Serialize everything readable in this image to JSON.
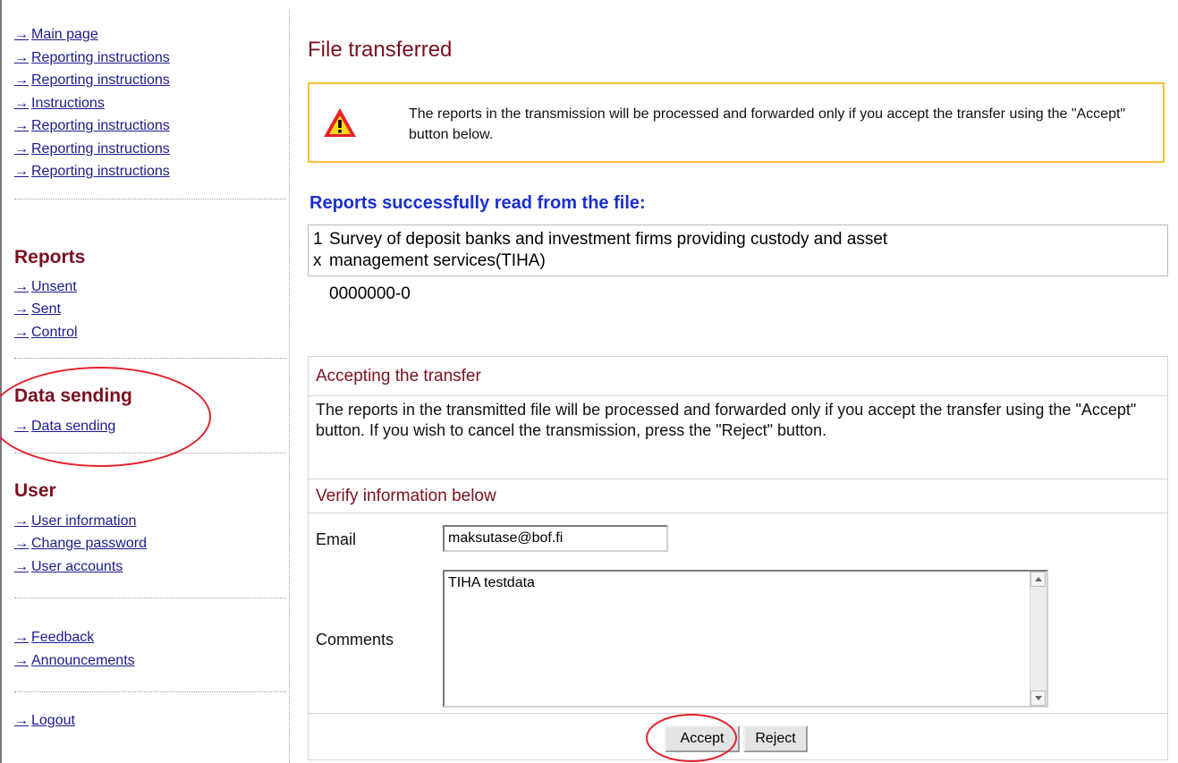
{
  "sidebar": {
    "top_links": [
      {
        "label": "Main page"
      },
      {
        "label": "Reporting instructions"
      },
      {
        "label": "Reporting instructions"
      },
      {
        "label": "Instructions"
      },
      {
        "label": "Reporting instructions"
      },
      {
        "label": "Reporting instructions"
      },
      {
        "label": "Reporting instructions"
      }
    ],
    "reports": {
      "heading": "Reports",
      "links": [
        {
          "label": "Unsent"
        },
        {
          "label": "Sent"
        },
        {
          "label": "Control"
        }
      ]
    },
    "data_sending": {
      "heading": "Data sending",
      "links": [
        {
          "label": "Data sending"
        }
      ]
    },
    "user": {
      "heading": "User",
      "links": [
        {
          "label": "User information"
        },
        {
          "label": "Change password"
        },
        {
          "label": "User accounts"
        }
      ]
    },
    "misc_links": [
      {
        "label": "Feedback"
      },
      {
        "label": "Announcements"
      }
    ],
    "logout": {
      "label": "Logout"
    }
  },
  "main": {
    "title": "File transferred",
    "warning": "The reports in the transmission will be processed and forwarded only if you accept the transfer using the \"Accept\" button below.",
    "reports_heading": "Reports successfully read from the file:",
    "report": {
      "num_top": "1",
      "num_bottom": "x",
      "line1": "Survey of deposit banks and investment firms providing custody and asset",
      "line2": "management services(TIHA)",
      "id": "0000000-0"
    },
    "accept_panel": {
      "heading": "Accepting the transfer",
      "body": "The reports in the transmitted file will be processed and forwarded only if you accept the transfer using the \"Accept\" button. If you wish to cancel the transmission, press the \"Reject\" button.",
      "verify_heading": "Verify information below",
      "email_label": "Email",
      "email_value": "maksutase@bof.fi",
      "comments_label": "Comments",
      "comments_value": "TIHA testdata",
      "accept_label": "Accept",
      "reject_label": "Reject"
    }
  },
  "colors": {
    "heading_maroon": "#7a1020",
    "subhead_blue": "#1a2fd0",
    "link_blue": "#1b1b8f",
    "warning_border": "#f2c12e",
    "annotation_red": "#e3202a"
  },
  "icons": {
    "warning": "warning-triangle-icon",
    "arrow": "arrow-right-icon"
  }
}
